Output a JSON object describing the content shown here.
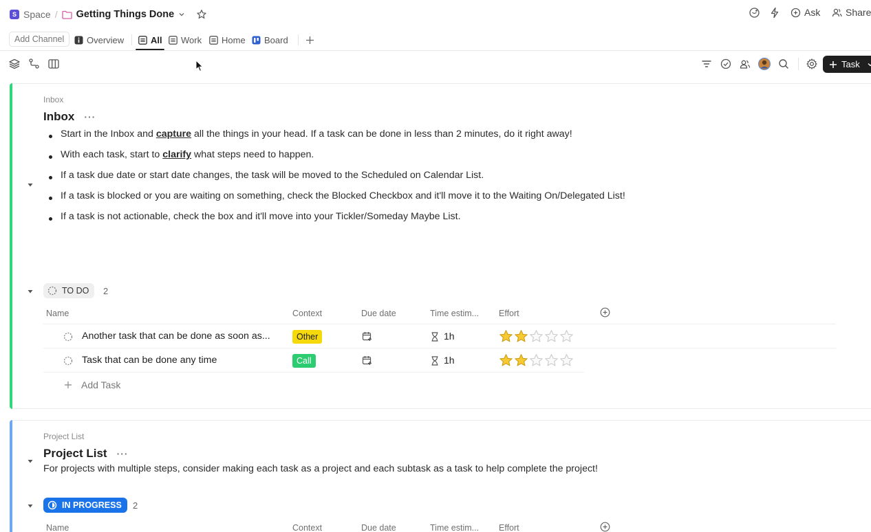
{
  "breadcrumb": {
    "space_badge": "S",
    "space": "Space",
    "separator": "/",
    "folder": "Getting Things Done"
  },
  "top_actions": {
    "ask": "Ask",
    "share": "Share"
  },
  "tabs": {
    "add_channel": "Add Channel",
    "items": [
      {
        "label": "Overview"
      },
      {
        "label": "All"
      },
      {
        "label": "Work"
      },
      {
        "label": "Home"
      },
      {
        "label": "Board"
      }
    ]
  },
  "toolbar": {
    "task_button": "Task"
  },
  "inbox": {
    "crumb": "Inbox",
    "title": "Inbox",
    "more": "···",
    "bullets": [
      {
        "pre": "Start in the Inbox and ",
        "bold": "capture",
        "post": " all the things in your head. If a task can be done in less than 2 minutes, do it right away!"
      },
      {
        "pre": "With each task, start to ",
        "bold": "clarify",
        "post": " what steps need to happen."
      },
      {
        "pre": "If a task due date or start date changes, the task will be moved to the Scheduled on Calendar List.",
        "bold": "",
        "post": ""
      },
      {
        "pre": "If a task is blocked or you are waiting on something, check the Blocked Checkbox and it'll move it to the Waiting On/Delegated List!",
        "bold": "",
        "post": ""
      },
      {
        "pre": "If a task is not actionable, check the box and it'll move into your Tickler/Someday Maybe List.",
        "bold": "",
        "post": ""
      }
    ],
    "status": {
      "label": "TO DO",
      "count": "2"
    },
    "columns": {
      "name": "Name",
      "context": "Context",
      "due": "Due date",
      "time": "Time estim...",
      "effort": "Effort"
    },
    "tasks": [
      {
        "name": "Another task that can be done as soon as...",
        "context": "Other",
        "context_color": "#f5d90a",
        "time": "1h",
        "effort": 2,
        "effort_max": 5
      },
      {
        "name": "Task that can be done any time",
        "context": "Call",
        "context_color": "#2ecc71",
        "time": "1h",
        "effort": 2,
        "effort_max": 5
      }
    ],
    "add_task": "Add Task",
    "accent": "#2fd67a"
  },
  "project": {
    "crumb": "Project List",
    "title": "Project List",
    "more": "···",
    "description": "For projects with multiple steps, consider making each task as a project and each subtask as a task to help complete the project!",
    "status": {
      "label": "IN PROGRESS",
      "count": "2",
      "color": "#1a73e8"
    },
    "columns": {
      "name": "Name",
      "context": "Context",
      "due": "Due date",
      "time": "Time estim...",
      "effort": "Effort"
    },
    "accent": "#6fa8ef"
  }
}
